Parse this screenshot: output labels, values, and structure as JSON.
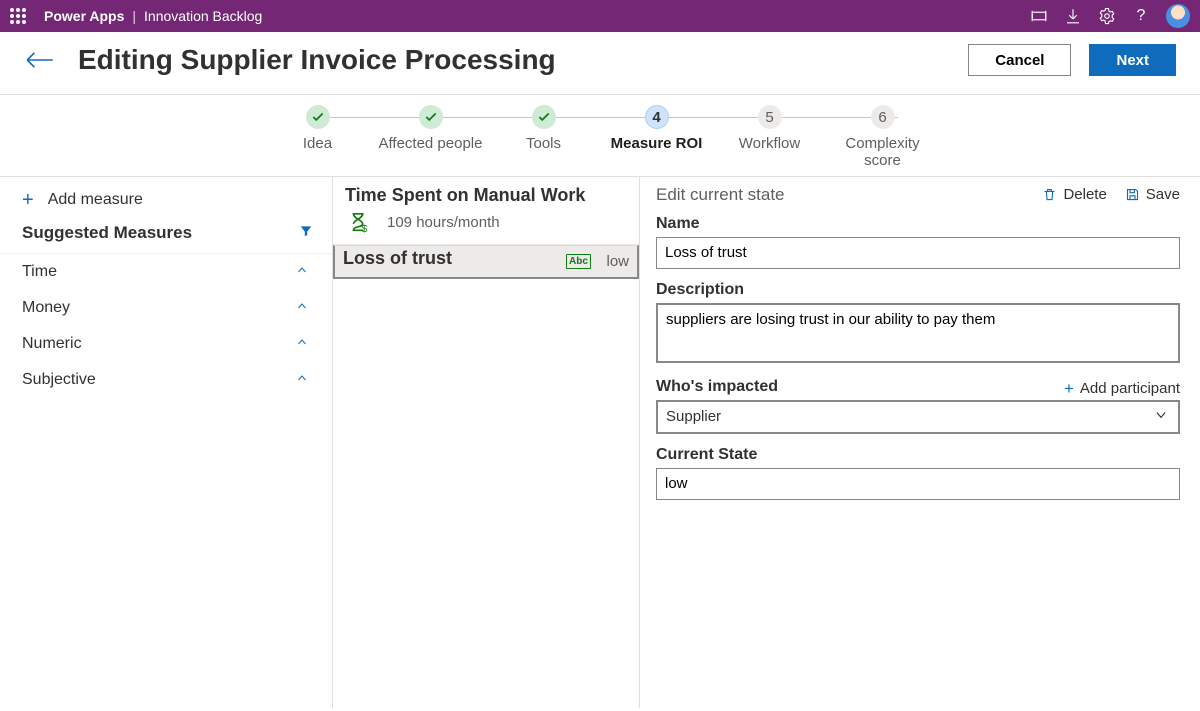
{
  "topbar": {
    "brand": "Power Apps",
    "app": "Innovation Backlog"
  },
  "header": {
    "title": "Editing Supplier Invoice Processing",
    "cancel": "Cancel",
    "next": "Next"
  },
  "steps": [
    {
      "label": "Idea",
      "state": "done",
      "mark": "✓"
    },
    {
      "label": "Affected people",
      "state": "done",
      "mark": "✓"
    },
    {
      "label": "Tools",
      "state": "done",
      "mark": "✓"
    },
    {
      "label": "Measure ROI",
      "state": "current",
      "mark": "4"
    },
    {
      "label": "Workflow",
      "state": "future",
      "mark": "5"
    },
    {
      "label": "Complexity score",
      "state": "future",
      "mark": "6"
    }
  ],
  "left": {
    "add": "Add measure",
    "heading": "Suggested Measures",
    "categories": [
      "Time",
      "Money",
      "Numeric",
      "Subjective"
    ]
  },
  "mid": {
    "cards": [
      {
        "title": "Time Spent on Manual Work",
        "subtitle": "109 hours/month",
        "icon": "hourglass"
      },
      {
        "title": "Loss of trust",
        "subtitle": "low",
        "icon": "abc",
        "selected": true
      }
    ]
  },
  "right": {
    "heading": "Edit current state",
    "delete": "Delete",
    "save": "Save",
    "fields": {
      "name_label": "Name",
      "name_value": "Loss of trust",
      "desc_label": "Description",
      "desc_value": "suppliers are losing trust in our ability to pay them",
      "who_label": "Who's impacted",
      "add_participant": "Add participant",
      "who_value": "Supplier",
      "current_label": "Current State",
      "current_value": "low"
    }
  }
}
